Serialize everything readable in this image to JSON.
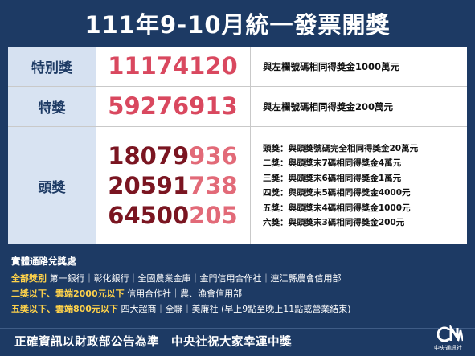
{
  "header": {
    "title": "111年9-10月統一發票開獎"
  },
  "prizes": {
    "special": {
      "label": "特別獎",
      "number": "11174120",
      "desc_prefix": "與左欄號碼相同得獎金",
      "desc_amount": "1000萬元"
    },
    "grand": {
      "label": "特獎",
      "number": "59276913",
      "desc_prefix": "與左欄號碼相同得獎金",
      "desc_amount": "200萬元"
    },
    "first": {
      "label": "頭獎",
      "numbers": [
        {
          "head": "18079",
          "tail": "936"
        },
        {
          "head": "20591",
          "tail": "738"
        },
        {
          "head": "64500",
          "tail": "205"
        }
      ],
      "tiers": [
        {
          "text": "頭獎：與頭獎號碼完全相同得獎金",
          "amount": "20萬元"
        },
        {
          "text": "二獎：與頭獎末7碼相同得獎金",
          "amount": "4萬元"
        },
        {
          "text": "三獎：與頭獎末6碼相同得獎金",
          "amount": "1萬元"
        },
        {
          "text": "四獎：與頭獎末5碼相同得獎金",
          "amount": "4000元"
        },
        {
          "text": "五獎：與頭獎末4碼相同得獎金",
          "amount": "1000元"
        },
        {
          "text": "六獎：與頭獎末3碼相同得獎金",
          "amount": "200元"
        }
      ]
    }
  },
  "redemption": {
    "title": "實體通路兌獎處",
    "lines": [
      {
        "highlight": "全部獎別",
        "text": "第一銀行｜彰化銀行｜全國農業金庫｜金門信用合作社｜連江縣農會信用部"
      },
      {
        "highlight": "二獎以下、雲端2000元以下",
        "text": "信用合作社｜農、漁會信用部"
      },
      {
        "highlight": "五獎以下、雲端800元以下",
        "text": "四大超商｜全聯｜美廉社 (早上9點至晚上11點或營業結束)"
      }
    ]
  },
  "footer": {
    "text": "正確資訊以財政部公告為準　中央社祝大家幸運中獎"
  },
  "logo": {
    "text": "中央通訊社"
  },
  "colors": {
    "navy": "#1d3a64",
    "pink": "#d9485f",
    "dark_red": "#7a1521",
    "yellow": "#ffd24a",
    "label_bg": "#d8e3f2"
  }
}
